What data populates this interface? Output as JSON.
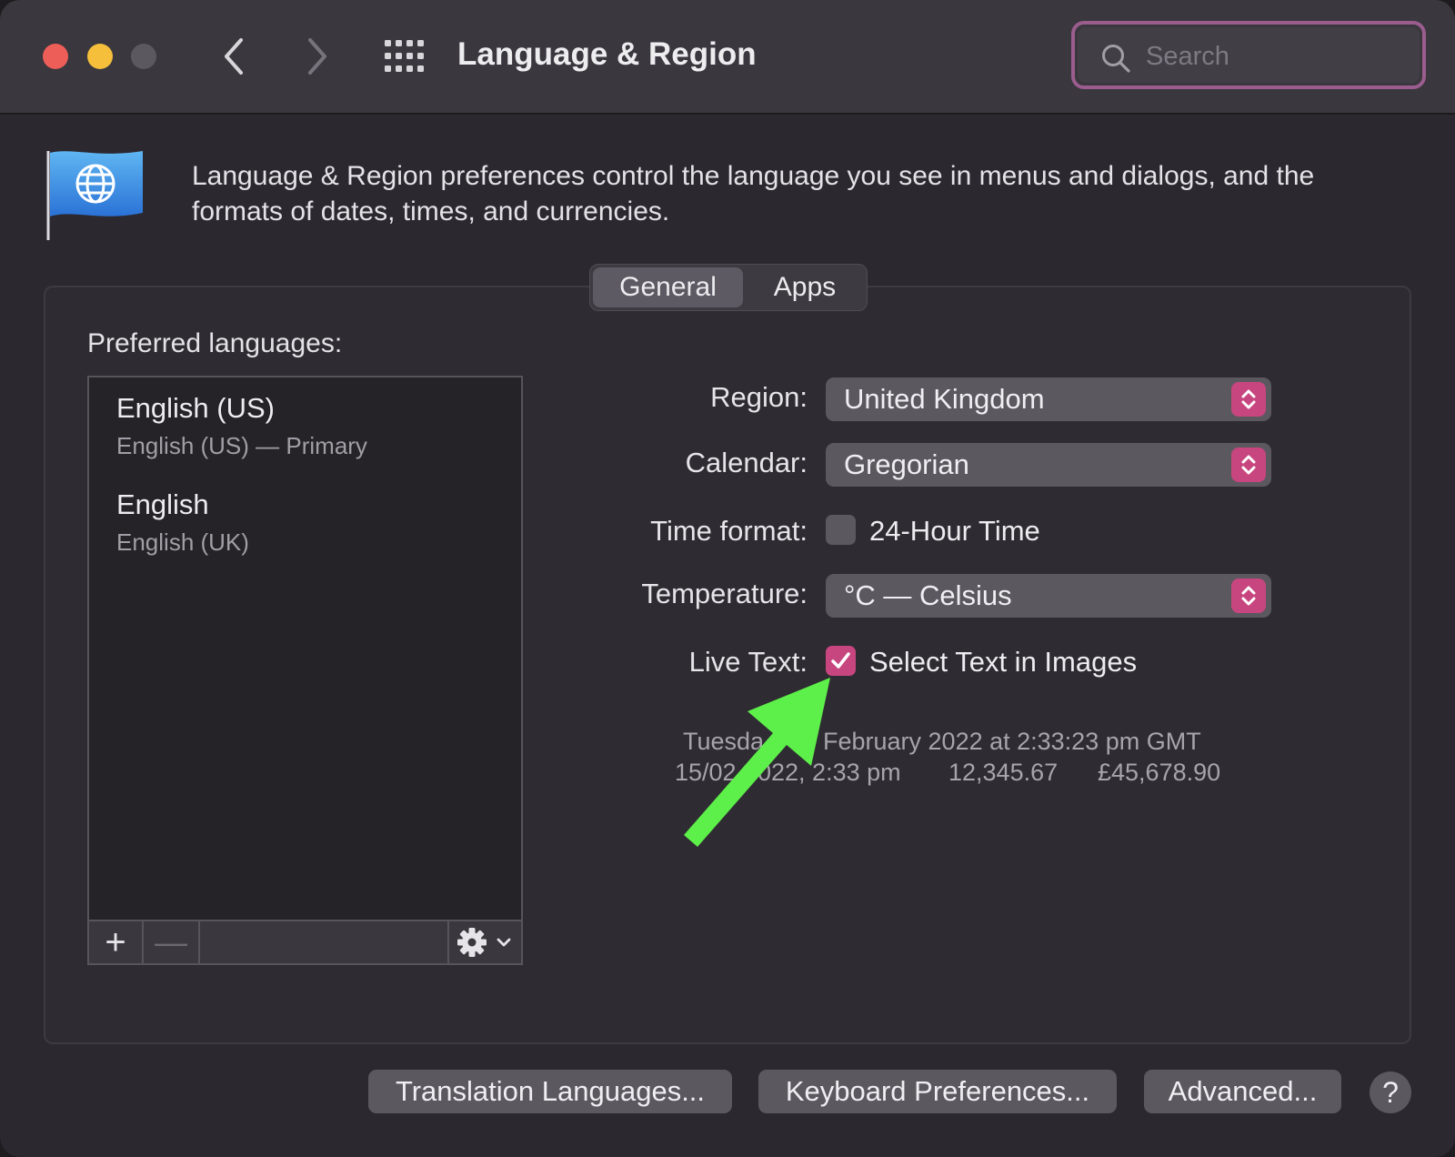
{
  "window": {
    "title": "Language & Region",
    "search_placeholder": "Search"
  },
  "header": {
    "description": "Language & Region preferences control the language you see in menus and dialogs, and the formats of dates, times, and currencies."
  },
  "tabs": [
    {
      "label": "General",
      "selected": true
    },
    {
      "label": "Apps",
      "selected": false
    }
  ],
  "languages": {
    "label": "Preferred languages:",
    "items": [
      {
        "name": "English (US)",
        "detail": "English (US) — Primary"
      },
      {
        "name": "English",
        "detail": "English (UK)"
      }
    ],
    "toolbar": {
      "add": "+",
      "remove": "—"
    }
  },
  "settings": {
    "region": {
      "label": "Region:",
      "value": "United Kingdom"
    },
    "calendar": {
      "label": "Calendar:",
      "value": "Gregorian"
    },
    "time_format": {
      "label": "Time format:",
      "option": "24-Hour Time",
      "checked": false
    },
    "temperature": {
      "label": "Temperature:",
      "value": "°C — Celsius"
    },
    "live_text": {
      "label": "Live Text:",
      "option": "Select Text in Images",
      "checked": true
    }
  },
  "sample": {
    "line1_start": "Tuesda",
    "line1_end": "February 2022 at 2:33:23 pm GMT",
    "line2_date_start": "15/02",
    "line2_date_end": "022, 2:33 pm",
    "number": "12,345.67",
    "currency": "£45,678.90"
  },
  "buttons": {
    "translation": "Translation Languages...",
    "keyboard": "Keyboard Preferences...",
    "advanced": "Advanced...",
    "help": "?"
  },
  "colors": {
    "accent": "#c8467f",
    "annotation_arrow": "#5ef04a",
    "search_focus_ring": "#9a5d8e"
  }
}
